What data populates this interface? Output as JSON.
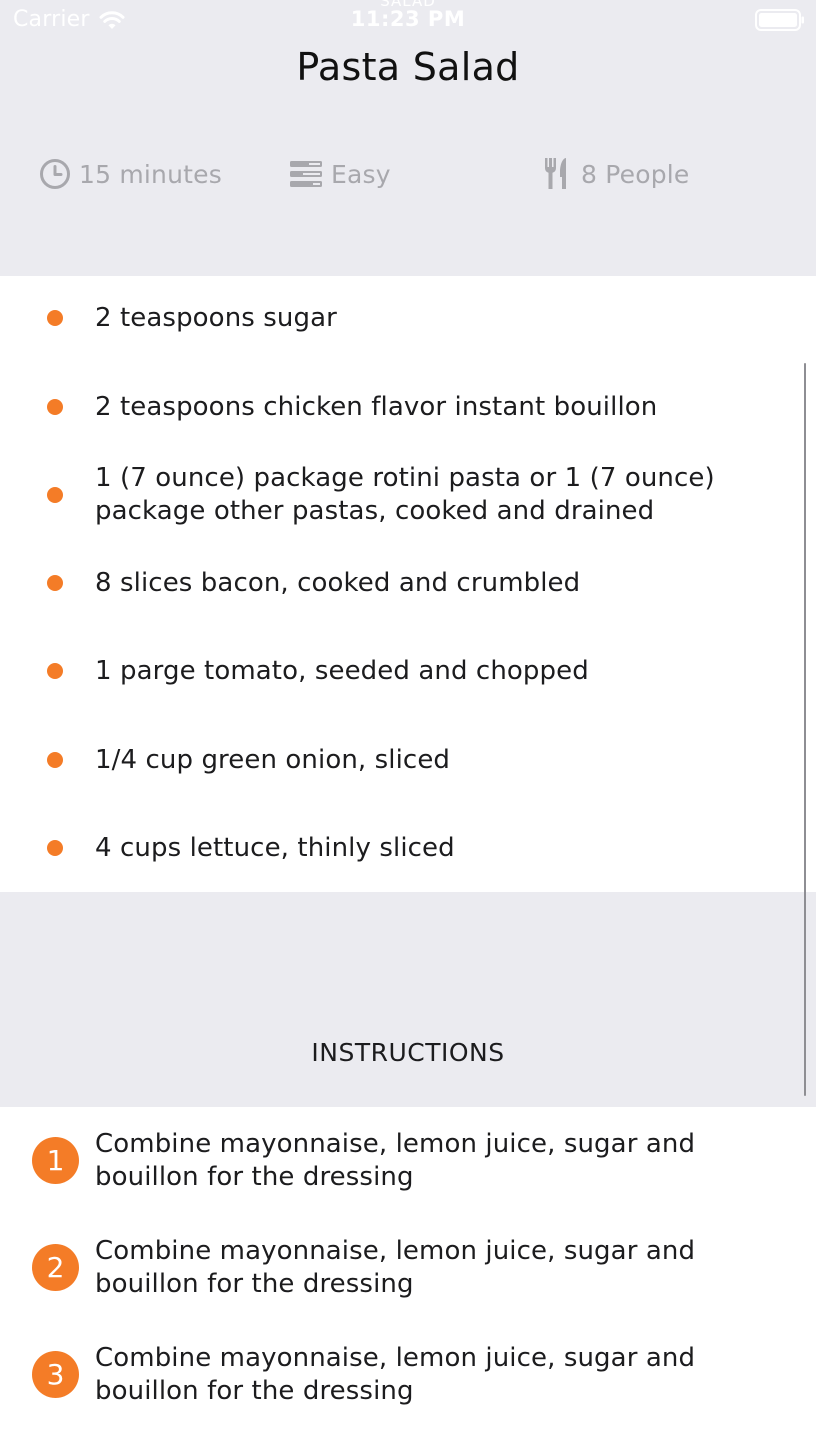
{
  "status_bar": {
    "carrier": "Carrier",
    "time": "11:23 PM",
    "nav_title_ghost": "SALAD",
    "icons": [
      "wifi-icon",
      "battery-icon"
    ]
  },
  "recipe": {
    "title": "Pasta Salad",
    "time": "15 minutes",
    "difficulty": "Easy",
    "serves": "8 People",
    "meta_icons": [
      "clock-icon",
      "difficulty-icon",
      "utensils-icon"
    ]
  },
  "ingredients": [
    "2 teaspoons sugar",
    "2 teaspoons chicken flavor instant bouillon",
    "1 (7 ounce) package rotini pasta or 1 (7 ounce) package other pastas, cooked and drained",
    "8 slices bacon, cooked and crumbled",
    "1 parge tomato, seeded and chopped",
    "1/4 cup green onion, sliced",
    "4 cups lettuce, thinly sliced"
  ],
  "instructions": {
    "title": "INSTRUCTIONS",
    "steps": [
      {
        "number": "1",
        "text": "Combine mayonnaise, lemon juice, sugar and bouillon for the dressing"
      },
      {
        "number": "2",
        "text": "Combine mayonnaise, lemon juice, sugar and bouillon for the dressing"
      },
      {
        "number": "3",
        "text": "Combine mayonnaise, lemon juice, sugar and bouillon for the dressing"
      }
    ]
  },
  "colors": {
    "accent": "#f47c27",
    "header_background": "#ebebf0",
    "meta_text": "#a8a8ad"
  }
}
